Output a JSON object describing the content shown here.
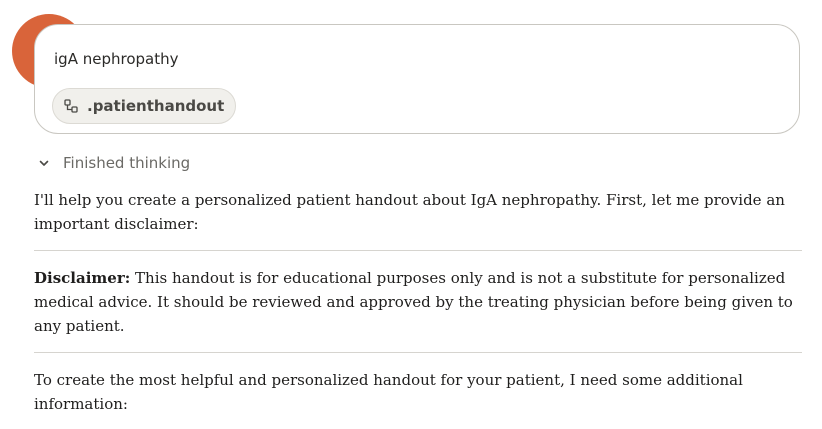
{
  "prompt": {
    "text": "igA nephropathy",
    "attachment_label": ".patienthandout",
    "attachment_icon": "style-icon"
  },
  "thinking": {
    "label": "Finished thinking",
    "icon": "chevron-down-icon"
  },
  "response": {
    "intro": "I'll help you create a personalized patient handout about IgA nephropathy. First, let me provide an important disclaimer:",
    "disclaimer_label": "Disclaimer:",
    "disclaimer_text": " This handout is for educational purposes only and is not a substitute for personalized medical advice. It should be reviewed and approved by the treating physician before being given to any patient.",
    "followup": "To create the most helpful and personalized handout for your patient, I need some additional information:"
  },
  "colors": {
    "accent": "#d9643a",
    "text": "#1f1e1d",
    "muted": "#6b6a66",
    "border": "#c9c7c1"
  }
}
